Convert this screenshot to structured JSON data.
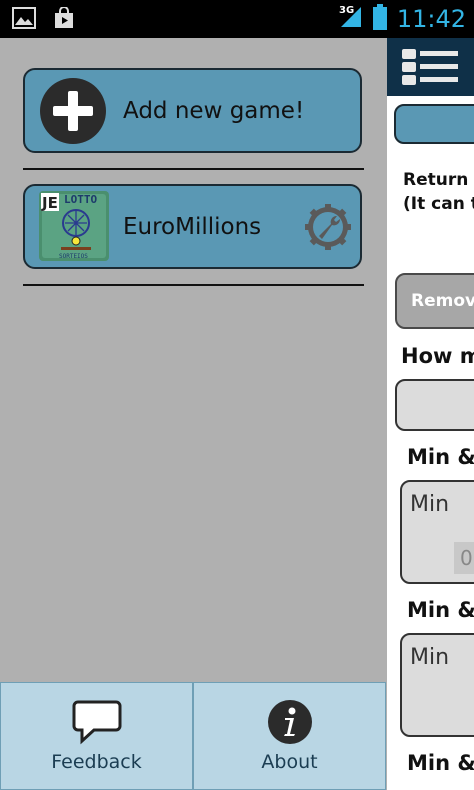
{
  "status_bar": {
    "network": "3G",
    "time": "11:42"
  },
  "drawer": {
    "add_game_label": "Add new game!",
    "games": [
      {
        "label": "EuroMillions",
        "logo_text": "LOTTO"
      }
    ]
  },
  "bottom_bar": {
    "feedback_label": "Feedback",
    "about_label": "About"
  },
  "right_panel": {
    "return_text_line1": "Return a",
    "return_text_line2": "(It can t",
    "remove_button": "Remov",
    "how_many_heading": "How m",
    "min_max_heading_1": "Min &",
    "min_label_1": "Min",
    "min_value_1": "0",
    "min_max_heading_2": "Min &",
    "min_label_2": "Min",
    "min_max_heading_3": "Min &"
  }
}
